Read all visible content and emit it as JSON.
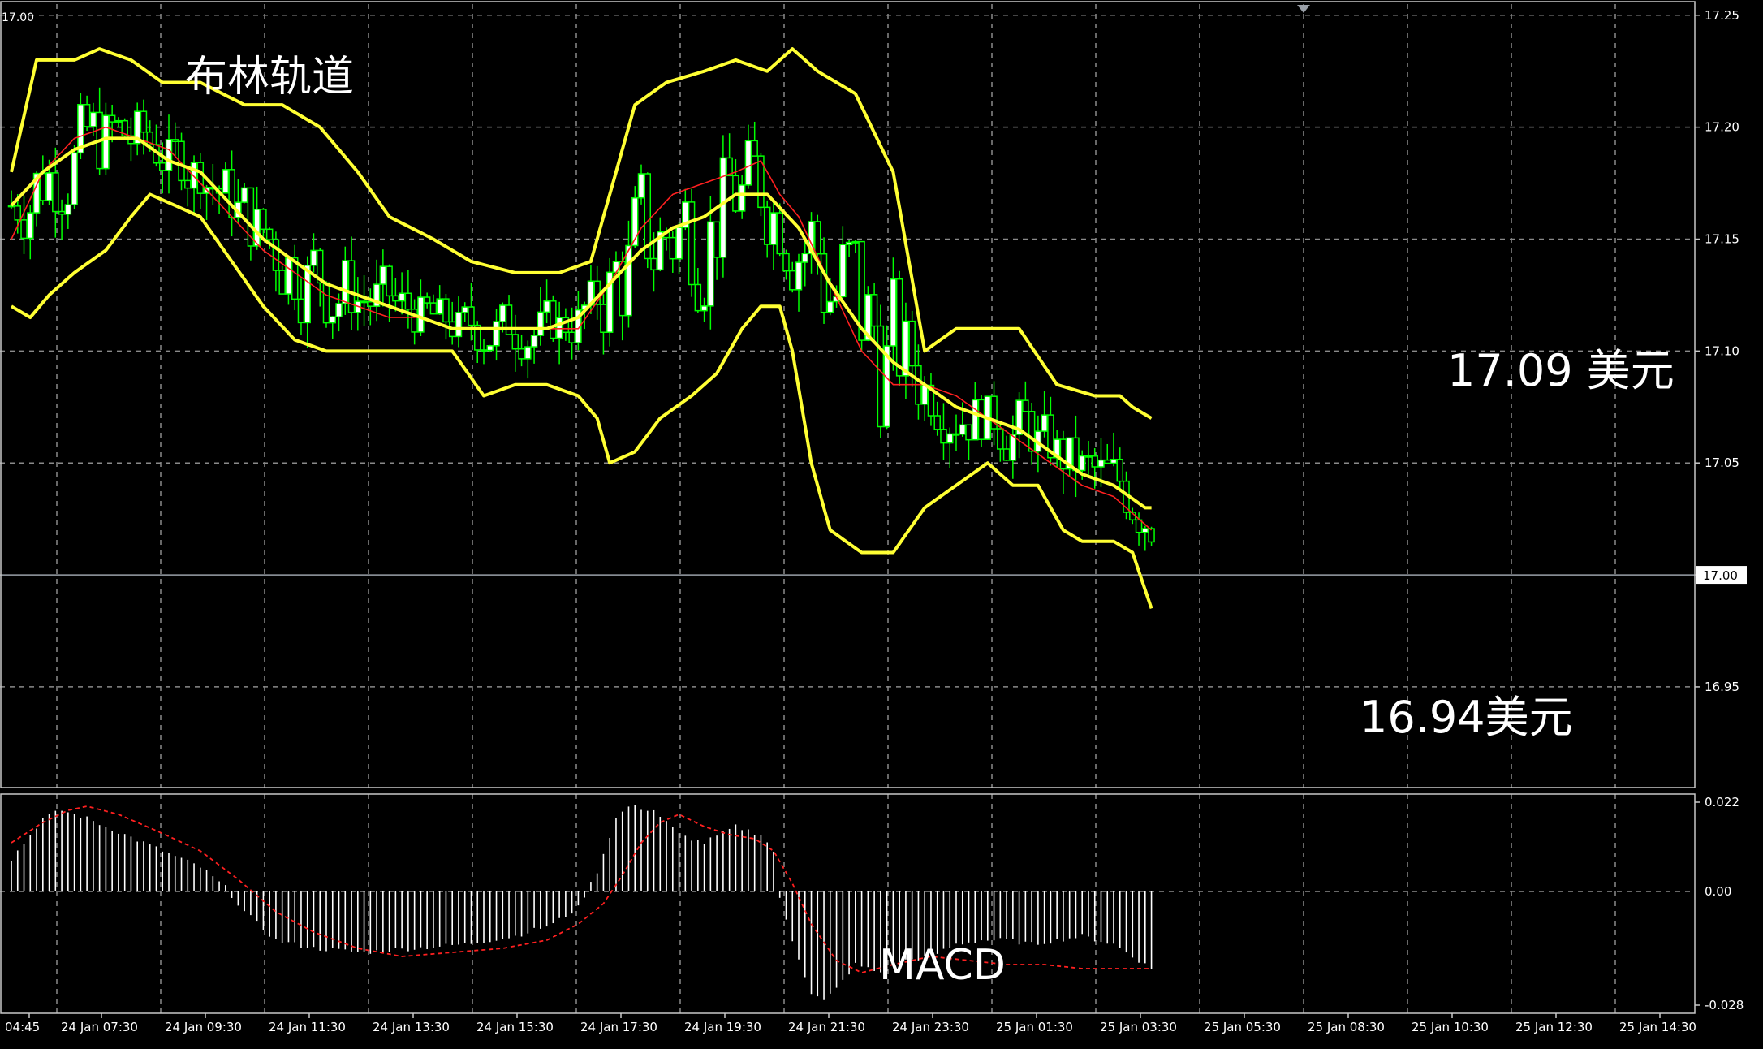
{
  "overlay": {
    "title": "布林轨道",
    "upper_note": "17.09 美元",
    "lower_note": "16.94美元",
    "macd_title": "MACD"
  },
  "corner_label": "17.00",
  "colors": {
    "background": "#000000",
    "grid": "#8a8a8a",
    "bollinger": "#ffff33",
    "ma": "#ff2020",
    "candle_up": "#ffffff",
    "candle_down": "#00ff00",
    "candle_border": "#00ff00",
    "price_line": "#9aa0a8",
    "histogram": "#ffffff",
    "signal": "#ff2020",
    "text": "#ffffff"
  },
  "chart_data": [
    {
      "type": "candlestick",
      "title": "布林轨道",
      "price_axis_ticks": [
        17.25,
        17.2,
        17.15,
        17.1,
        17.05,
        17.0,
        16.95
      ],
      "price_axis_labels": [
        "17.25",
        "17.20",
        "17.15",
        "17.10",
        "17.05",
        "17.00",
        "16.95"
      ],
      "ylim": [
        16.905,
        17.255
      ],
      "current_price": 17.0,
      "current_price_label": "17.00",
      "time_labels": [
        "04:45",
        "24 Jan 07:30",
        "24 Jan 09:30",
        "24 Jan 11:30",
        "24 Jan 13:30",
        "24 Jan 15:30",
        "24 Jan 17:30",
        "24 Jan 19:30",
        "24 Jan 21:30",
        "24 Jan 23:30",
        "25 Jan 01:30",
        "25 Jan 03:30",
        "25 Jan 05:30",
        "25 Jan 08:30",
        "25 Jan 10:30",
        "25 Jan 12:30",
        "25 Jan 14:30"
      ],
      "bar_count": 185,
      "key_points": {
        "upper": [
          [
            0,
            17.18
          ],
          [
            4,
            17.23
          ],
          [
            10,
            17.23
          ],
          [
            14,
            17.235
          ],
          [
            19,
            17.23
          ],
          [
            24,
            17.22
          ],
          [
            30,
            17.22
          ],
          [
            37,
            17.21
          ],
          [
            43,
            17.21
          ],
          [
            49,
            17.2
          ],
          [
            55,
            17.18
          ],
          [
            60,
            17.16
          ],
          [
            67,
            17.15
          ],
          [
            73,
            17.14
          ],
          [
            80,
            17.135
          ],
          [
            87,
            17.135
          ],
          [
            92,
            17.14
          ],
          [
            96,
            17.18
          ],
          [
            99,
            17.21
          ],
          [
            104,
            17.22
          ],
          [
            110,
            17.225
          ],
          [
            115,
            17.23
          ],
          [
            120,
            17.225
          ],
          [
            124,
            17.235
          ],
          [
            128,
            17.225
          ],
          [
            134,
            17.215
          ],
          [
            140,
            17.18
          ],
          [
            145,
            17.1
          ],
          [
            150,
            17.11
          ],
          [
            155,
            17.11
          ],
          [
            160,
            17.11
          ],
          [
            166,
            17.085
          ],
          [
            172,
            17.08
          ],
          [
            176,
            17.08
          ],
          [
            178,
            17.075
          ],
          [
            181,
            17.07
          ]
        ],
        "middle": [
          [
            0,
            17.165
          ],
          [
            5,
            17.18
          ],
          [
            10,
            17.19
          ],
          [
            15,
            17.195
          ],
          [
            20,
            17.195
          ],
          [
            25,
            17.185
          ],
          [
            30,
            17.18
          ],
          [
            35,
            17.165
          ],
          [
            40,
            17.15
          ],
          [
            45,
            17.14
          ],
          [
            50,
            17.13
          ],
          [
            55,
            17.125
          ],
          [
            60,
            17.12
          ],
          [
            65,
            17.115
          ],
          [
            70,
            17.11
          ],
          [
            75,
            17.11
          ],
          [
            80,
            17.11
          ],
          [
            85,
            17.11
          ],
          [
            90,
            17.115
          ],
          [
            95,
            17.13
          ],
          [
            100,
            17.145
          ],
          [
            105,
            17.155
          ],
          [
            110,
            17.16
          ],
          [
            115,
            17.17
          ],
          [
            120,
            17.17
          ],
          [
            125,
            17.155
          ],
          [
            130,
            17.13
          ],
          [
            135,
            17.11
          ],
          [
            140,
            17.095
          ],
          [
            145,
            17.085
          ],
          [
            150,
            17.075
          ],
          [
            155,
            17.07
          ],
          [
            160,
            17.065
          ],
          [
            165,
            17.055
          ],
          [
            170,
            17.045
          ],
          [
            175,
            17.04
          ],
          [
            180,
            17.03
          ],
          [
            181,
            17.03
          ]
        ],
        "lower": [
          [
            0,
            17.12
          ],
          [
            3,
            17.115
          ],
          [
            6,
            17.125
          ],
          [
            10,
            17.135
          ],
          [
            15,
            17.145
          ],
          [
            19,
            17.16
          ],
          [
            22,
            17.17
          ],
          [
            26,
            17.165
          ],
          [
            30,
            17.16
          ],
          [
            35,
            17.14
          ],
          [
            40,
            17.12
          ],
          [
            45,
            17.105
          ],
          [
            50,
            17.1
          ],
          [
            55,
            17.1
          ],
          [
            60,
            17.1
          ],
          [
            65,
            17.1
          ],
          [
            70,
            17.1
          ],
          [
            75,
            17.08
          ],
          [
            80,
            17.085
          ],
          [
            85,
            17.085
          ],
          [
            90,
            17.08
          ],
          [
            93,
            17.07
          ],
          [
            95,
            17.05
          ],
          [
            99,
            17.055
          ],
          [
            103,
            17.07
          ],
          [
            108,
            17.08
          ],
          [
            112,
            17.09
          ],
          [
            116,
            17.11
          ],
          [
            119,
            17.12
          ],
          [
            122,
            17.12
          ],
          [
            124,
            17.1
          ],
          [
            127,
            17.05
          ],
          [
            130,
            17.02
          ],
          [
            135,
            17.01
          ],
          [
            140,
            17.01
          ],
          [
            145,
            17.03
          ],
          [
            150,
            17.04
          ],
          [
            155,
            17.05
          ],
          [
            159,
            17.04
          ],
          [
            163,
            17.04
          ],
          [
            167,
            17.02
          ],
          [
            170,
            17.015
          ],
          [
            175,
            17.015
          ],
          [
            178,
            17.01
          ],
          [
            181,
            16.985
          ]
        ],
        "ma": [
          [
            0,
            17.15
          ],
          [
            5,
            17.18
          ],
          [
            10,
            17.195
          ],
          [
            15,
            17.2
          ],
          [
            20,
            17.195
          ],
          [
            25,
            17.19
          ],
          [
            30,
            17.175
          ],
          [
            35,
            17.16
          ],
          [
            40,
            17.145
          ],
          [
            45,
            17.135
          ],
          [
            50,
            17.125
          ],
          [
            55,
            17.12
          ],
          [
            60,
            17.115
          ],
          [
            65,
            17.115
          ],
          [
            70,
            17.11
          ],
          [
            75,
            17.11
          ],
          [
            80,
            17.11
          ],
          [
            85,
            17.11
          ],
          [
            90,
            17.11
          ],
          [
            95,
            17.13
          ],
          [
            100,
            17.155
          ],
          [
            105,
            17.17
          ],
          [
            110,
            17.175
          ],
          [
            115,
            17.18
          ],
          [
            119,
            17.185
          ],
          [
            122,
            17.17
          ],
          [
            125,
            17.16
          ],
          [
            130,
            17.13
          ],
          [
            135,
            17.1
          ],
          [
            140,
            17.085
          ],
          [
            145,
            17.085
          ],
          [
            150,
            17.08
          ],
          [
            155,
            17.07
          ],
          [
            160,
            17.06
          ],
          [
            165,
            17.05
          ],
          [
            170,
            17.04
          ],
          [
            175,
            17.035
          ],
          [
            181,
            17.02
          ]
        ]
      },
      "annotations": [
        {
          "text": "17.09 美元",
          "target": 17.09
        },
        {
          "text": "16.94美元",
          "target": 16.94
        }
      ]
    },
    {
      "type": "histogram",
      "title": "MACD",
      "axis_ticks": [
        0.022,
        0.0,
        -0.028
      ],
      "axis_labels": [
        "0.022",
        "0.00",
        "-0.028"
      ],
      "ylim": [
        -0.03,
        0.024
      ],
      "bar_count": 182,
      "hist_key_points": [
        [
          0,
          0.008
        ],
        [
          5,
          0.018
        ],
        [
          8,
          0.02
        ],
        [
          12,
          0.018
        ],
        [
          18,
          0.014
        ],
        [
          24,
          0.01
        ],
        [
          30,
          0.006
        ],
        [
          34,
          0.001
        ],
        [
          37,
          -0.005
        ],
        [
          42,
          -0.012
        ],
        [
          48,
          -0.014
        ],
        [
          56,
          -0.015
        ],
        [
          64,
          -0.014
        ],
        [
          72,
          -0.013
        ],
        [
          80,
          -0.011
        ],
        [
          86,
          -0.008
        ],
        [
          90,
          -0.004
        ],
        [
          93,
          0.005
        ],
        [
          96,
          0.018
        ],
        [
          98,
          0.021
        ],
        [
          102,
          0.02
        ],
        [
          106,
          0.014
        ],
        [
          110,
          0.012
        ],
        [
          115,
          0.016
        ],
        [
          119,
          0.014
        ],
        [
          121,
          0.01
        ],
        [
          122,
          -0.002
        ],
        [
          124,
          -0.012
        ],
        [
          127,
          -0.025
        ],
        [
          129,
          -0.027
        ],
        [
          131,
          -0.024
        ],
        [
          134,
          -0.018
        ],
        [
          138,
          -0.02
        ],
        [
          142,
          -0.017
        ],
        [
          146,
          -0.016
        ],
        [
          150,
          -0.013
        ],
        [
          154,
          -0.012
        ],
        [
          158,
          -0.012
        ],
        [
          162,
          -0.013
        ],
        [
          166,
          -0.012
        ],
        [
          170,
          -0.011
        ],
        [
          175,
          -0.013
        ],
        [
          181,
          -0.019
        ]
      ],
      "signal_key_points": [
        [
          0,
          0.012
        ],
        [
          5,
          0.017
        ],
        [
          9,
          0.02
        ],
        [
          12,
          0.021
        ],
        [
          17,
          0.019
        ],
        [
          23,
          0.015
        ],
        [
          30,
          0.01
        ],
        [
          36,
          0.003
        ],
        [
          42,
          -0.005
        ],
        [
          48,
          -0.01
        ],
        [
          55,
          -0.014
        ],
        [
          62,
          -0.016
        ],
        [
          70,
          -0.015
        ],
        [
          78,
          -0.014
        ],
        [
          85,
          -0.012
        ],
        [
          90,
          -0.008
        ],
        [
          94,
          -0.003
        ],
        [
          97,
          0.004
        ],
        [
          100,
          0.012
        ],
        [
          103,
          0.017
        ],
        [
          106,
          0.019
        ],
        [
          110,
          0.016
        ],
        [
          114,
          0.014
        ],
        [
          118,
          0.013
        ],
        [
          121,
          0.01
        ],
        [
          124,
          0.002
        ],
        [
          127,
          -0.008
        ],
        [
          131,
          -0.017
        ],
        [
          135,
          -0.02
        ],
        [
          140,
          -0.018
        ],
        [
          146,
          -0.016
        ],
        [
          152,
          -0.017
        ],
        [
          158,
          -0.018
        ],
        [
          164,
          -0.018
        ],
        [
          170,
          -0.019
        ],
        [
          176,
          -0.019
        ],
        [
          181,
          -0.019
        ]
      ]
    }
  ]
}
